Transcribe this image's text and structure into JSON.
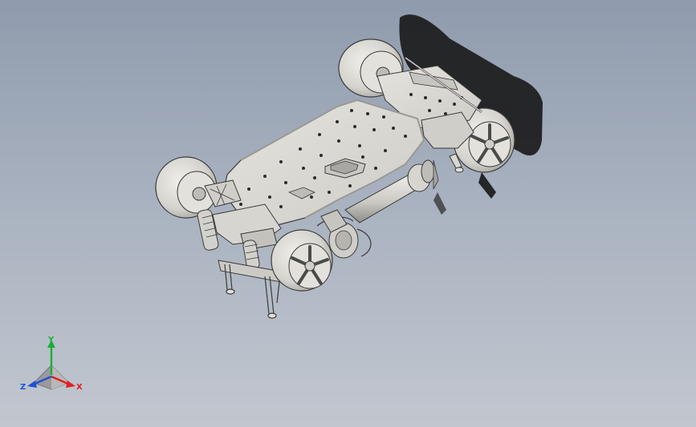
{
  "viewport": {
    "background_top": "#8f9bad",
    "background_bottom": "#c2c7cf"
  },
  "model": {
    "part_color": "#d9d8d4",
    "edge_color": "#3a3a3a",
    "hole_color": "#2b2b2b",
    "shadow_color": "#1a1a1a"
  },
  "triad": {
    "x_label": "X",
    "y_label": "Y",
    "z_label": "Z",
    "x_color": "#e02020",
    "y_color": "#18b038",
    "z_color": "#2050d8"
  }
}
